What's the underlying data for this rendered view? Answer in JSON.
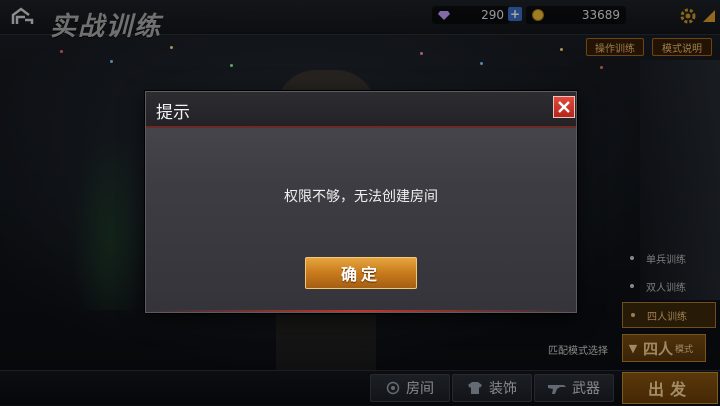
{
  "header": {
    "title": "实战训练",
    "diamonds": "290",
    "gold": "33689",
    "op_training_label": "操作训练",
    "mode_explain_label": "模式说明"
  },
  "modes": {
    "items": [
      {
        "label": "单兵训练",
        "active": false
      },
      {
        "label": "双人训练",
        "active": false
      },
      {
        "label": "四人训练",
        "active": true
      }
    ],
    "match_label": "匹配模式选择",
    "match_value": "四人",
    "match_suffix": "模式"
  },
  "bottom": {
    "room_label": "房间",
    "outfit_label": "装饰",
    "weapon_label": "武器",
    "start_label": "出发"
  },
  "dialog": {
    "title": "提示",
    "message": "权限不够，无法创建房间",
    "confirm_label": "确定"
  },
  "colors": {
    "accent_orange": "#c87a1c",
    "close_red": "#d23a2d",
    "dialog_bg": "#3d3d43"
  }
}
